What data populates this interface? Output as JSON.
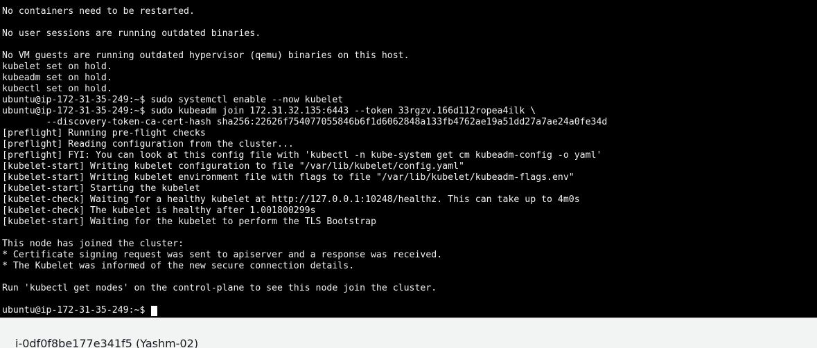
{
  "terminal": {
    "lines": [
      "No containers need to be restarted.",
      "",
      "No user sessions are running outdated binaries.",
      "",
      "No VM guests are running outdated hypervisor (qemu) binaries on this host.",
      "kubelet set on hold.",
      "kubeadm set on hold.",
      "kubectl set on hold.",
      "ubuntu@ip-172-31-35-249:~$ sudo systemctl enable --now kubelet",
      "ubuntu@ip-172-31-35-249:~$ sudo kubeadm join 172.31.32.135:6443 --token 33rgzv.166d112ropea4ilk \\",
      "        --discovery-token-ca-cert-hash sha256:22626f754077055846b6f1d6062848a133fb4762ae19a51dd27a7ae24a0fe34d",
      "[preflight] Running pre-flight checks",
      "[preflight] Reading configuration from the cluster...",
      "[preflight] FYI: You can look at this config file with 'kubectl -n kube-system get cm kubeadm-config -o yaml'",
      "[kubelet-start] Writing kubelet configuration to file \"/var/lib/kubelet/config.yaml\"",
      "[kubelet-start] Writing kubelet environment file with flags to file \"/var/lib/kubelet/kubeadm-flags.env\"",
      "[kubelet-start] Starting the kubelet",
      "[kubelet-check] Waiting for a healthy kubelet at http://127.0.0.1:10248/healthz. This can take up to 4m0s",
      "[kubelet-check] The kubelet is healthy after 1.001800299s",
      "[kubelet-start] Waiting for the kubelet to perform the TLS Bootstrap",
      "",
      "This node has joined the cluster:",
      "* Certificate signing request was sent to apiserver and a response was received.",
      "* The Kubelet was informed of the new secure connection details.",
      "",
      "Run 'kubectl get nodes' on the control-plane to see this node join the cluster.",
      ""
    ],
    "prompt": "ubuntu@ip-172-31-35-249:~$ "
  },
  "instance_bar": {
    "title": "i-0df0f8be177e341f5 (Yashm-02)"
  },
  "colors": {
    "terminal_bg": "#000000",
    "terminal_fg": "#f2f2f2",
    "bar_bg": "#f2f3f3",
    "bar_text": "#16191f"
  }
}
